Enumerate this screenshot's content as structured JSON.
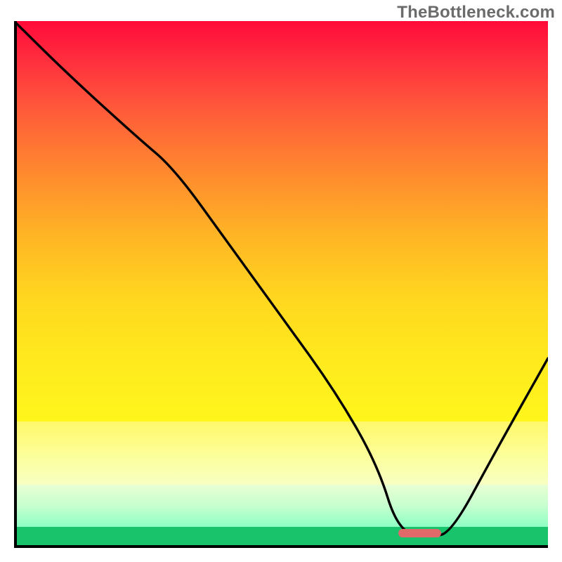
{
  "watermark": "TheBottleneck.com",
  "plot": {
    "width_units": 100,
    "height_units": 100,
    "x_range": [
      0,
      100
    ],
    "y_range": [
      0,
      100
    ]
  },
  "chart_data": {
    "type": "line",
    "title": "",
    "xlabel": "",
    "ylabel": "",
    "xlim": [
      0,
      100
    ],
    "ylim": [
      0,
      100
    ],
    "series": [
      {
        "name": "curve",
        "x": [
          0,
          10,
          23,
          30,
          40,
          50,
          60,
          68,
          72,
          78,
          82,
          90,
          100
        ],
        "y": [
          100,
          90,
          78,
          72,
          58,
          44,
          30,
          16,
          3,
          2,
          3,
          18,
          36
        ]
      }
    ],
    "marker": {
      "name": "highlight-segment",
      "x_start": 72,
      "x_end": 80,
      "y": 2,
      "color": "#e06a6a"
    },
    "gradient_stops_y": [
      {
        "y": 100,
        "color": "#ff0a3a"
      },
      {
        "y": 76,
        "color": "#fff61c"
      },
      {
        "y": 88,
        "color": "#fcff9f"
      },
      {
        "y": 96,
        "color": "#8dffc3"
      },
      {
        "y": 100,
        "color": "#18c36b"
      }
    ]
  }
}
